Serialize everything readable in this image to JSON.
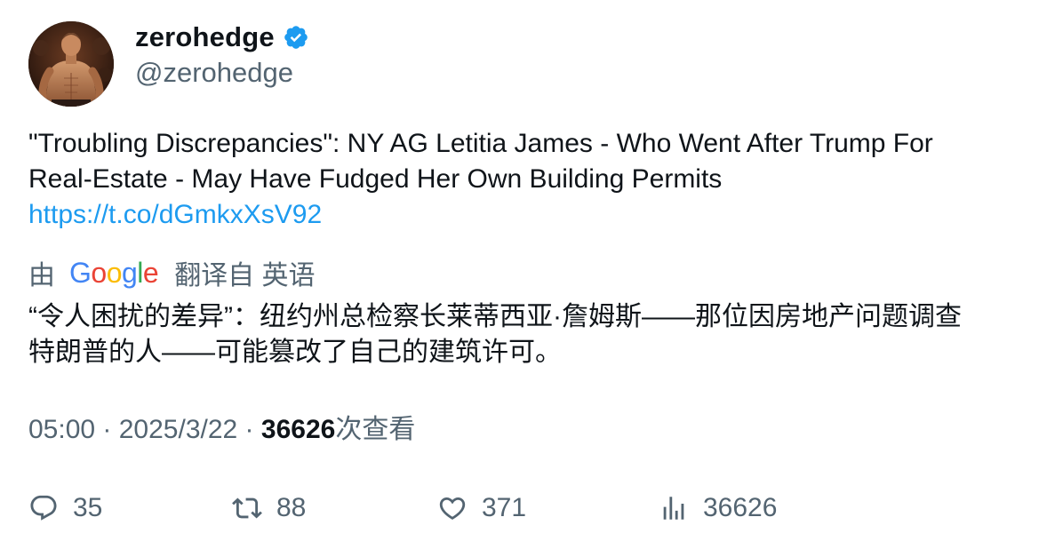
{
  "user": {
    "display_name": "zerohedge",
    "handle": "@zerohedge",
    "verified": true
  },
  "tweet": {
    "text_line1": "\"Troubling Discrepancies\": NY AG Letitia James - Who Went After Trump For",
    "text_line2": "Real-Estate - May Have Fudged Her Own Building Permits",
    "link": "https://t.co/dGmkxXsV92"
  },
  "translation": {
    "by_label": "由",
    "google_letters": [
      "G",
      "o",
      "o",
      "g",
      "l",
      "e"
    ],
    "translated_from": "翻译自 英语",
    "text_line1": "“令人困扰的差异”：纽约州总检察长莱蒂西亚·詹姆斯——那位因房地产问题调查",
    "text_line2": "特朗普的人——可能篡改了自己的建筑许可。"
  },
  "meta": {
    "time": "05:00",
    "separator": " · ",
    "date": "2025/3/22",
    "views_count": "36626",
    "views_label": "次查看"
  },
  "actions": {
    "replies": "35",
    "retweets": "88",
    "likes": "371",
    "views": "36626"
  },
  "colors": {
    "link": "#1d9bf0",
    "secondary_text": "#536471",
    "primary_text": "#0f1419",
    "verified_badge": "#1d9bf0",
    "google_blue": "#4285F4",
    "google_red": "#EA4335",
    "google_yellow": "#FBBC05",
    "google_green": "#34A853"
  }
}
